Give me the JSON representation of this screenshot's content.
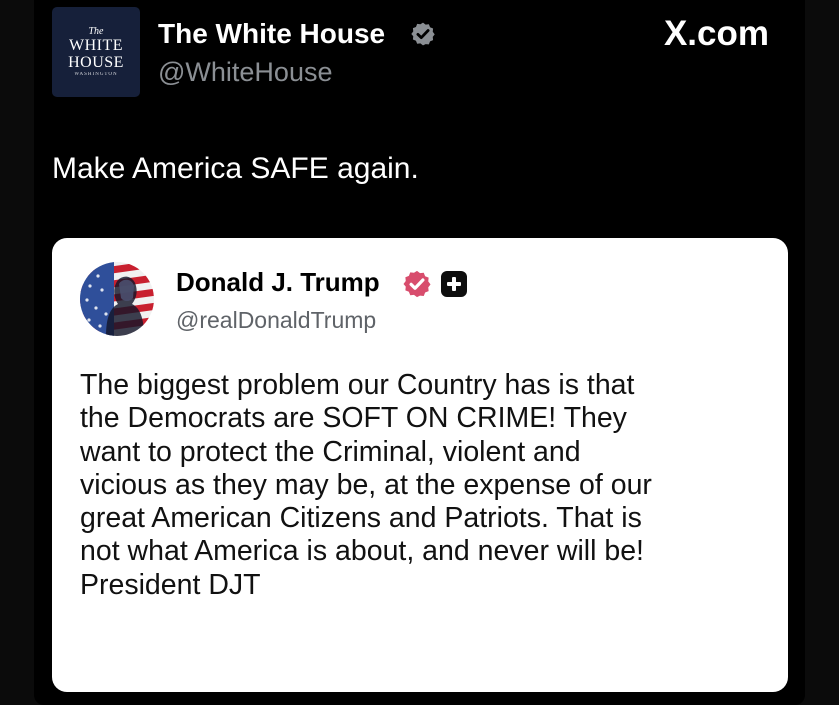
{
  "brand": "X.com",
  "post": {
    "avatar_logo": {
      "line1": "The",
      "line2": "WHITE",
      "line3": "HOUSE",
      "line4": "WASHINGTON"
    },
    "author_name": "The White House",
    "author_handle": "@WhiteHouse",
    "verified_badge_color": "#8b8f94",
    "text": "Make America SAFE again."
  },
  "quoted_post": {
    "author_name": "Donald J. Trump",
    "author_handle": "@realDonaldTrump",
    "verified_badge_color": "#d84d6d",
    "body_lines": [
      "The biggest problem our Country has is that",
      "the Democrats are SOFT ON CRIME! They",
      "want to protect the Criminal, violent and",
      "vicious as they may be, at the expense of our",
      "great American Citizens and Patriots. That is",
      "not what America is about, and never will be!",
      "President DJT"
    ]
  },
  "icons": {
    "verified": "verified-badge-icon",
    "follow_plus": "plus-icon",
    "avatar": "flag-portrait-avatar"
  }
}
